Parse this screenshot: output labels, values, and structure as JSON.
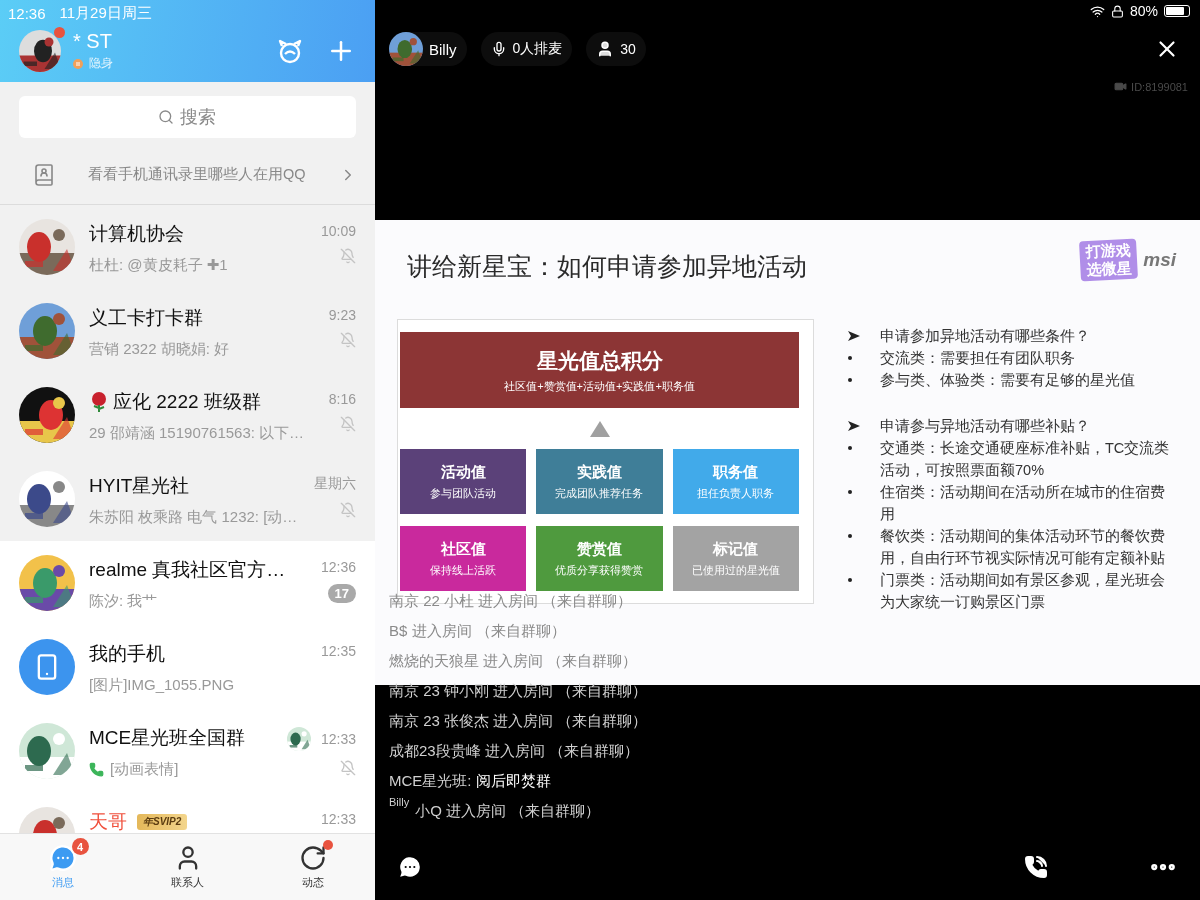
{
  "status_bar": {
    "time": "12:36",
    "date": "11月29日周三",
    "battery": "80%"
  },
  "profile": {
    "name": "* ST",
    "status": "隐身",
    "notification_dot": true
  },
  "search": {
    "placeholder": "搜索"
  },
  "contacts_prompt": "看看手机通讯录里哪些人在用QQ",
  "chats": [
    {
      "name": "计算机协会",
      "preview": "杜杜: @黄皮耗子 ✚1",
      "time": "10:09",
      "muted": true,
      "pinned": true,
      "vip": false
    },
    {
      "name": "义工卡打卡群",
      "preview": "营销 2322 胡晓娟: 好",
      "time": "9:23",
      "muted": true,
      "pinned": true,
      "vip": false
    },
    {
      "rose": true,
      "name": "应化 2222 班级群",
      "preview": "29 邵靖涵 15190761563: 以下…",
      "time": "8:16",
      "muted": true,
      "pinned": true,
      "vip": false
    },
    {
      "name": "HYIT星光社",
      "preview": "朱苏阳 枚乘路 电气 1232: [动…",
      "time": "星期六",
      "muted": true,
      "pinned": true,
      "vip": false
    },
    {
      "name": "realme 真我社区官方…",
      "preview": "陈汐: 我艹",
      "time": "12:36",
      "badge": "17",
      "muted": false,
      "pinned": false,
      "vip": false
    },
    {
      "avatar": {
        "kind": "phone"
      },
      "name": "我的手机",
      "preview": "[图片]IMG_1055.PNG",
      "time": "12:35",
      "muted": false,
      "pinned": false,
      "vip": false
    },
    {
      "name": "MCE星光班全国群",
      "preview": "[动画表情]",
      "call": true,
      "sticker": true,
      "time": "12:33",
      "muted": true,
      "pinned": false,
      "vip": false
    },
    {
      "name": "天哥",
      "tag": "年SVIP2",
      "time": "12:33",
      "muted": false,
      "pinned": false,
      "vip": true
    }
  ],
  "tabs": [
    {
      "label": "消息",
      "selected": true,
      "badge": "4",
      "dot": false
    },
    {
      "label": "联系人",
      "selected": false,
      "dot": false
    },
    {
      "label": "动态",
      "selected": false,
      "dot": true
    }
  ],
  "room": {
    "host": "Billy",
    "queue": "0人排麦",
    "audience": "30",
    "room_id": "ID:8199081"
  },
  "slide": {
    "title": "讲给新星宝：如何申请参加异地活动",
    "logo": {
      "line1": "打游戏",
      "line2": "选微星",
      "brand": "msi"
    },
    "total": {
      "title": "星光值总积分",
      "formula": "社区值+赞赏值+活动值+实践值+职务值"
    },
    "tiles": [
      {
        "title": "活动值",
        "subtitle": "参与团队活动",
        "color": "#5b4179"
      },
      {
        "title": "实践值",
        "subtitle": "完成团队推荐任务",
        "color": "#3f7e98"
      },
      {
        "title": "职务值",
        "subtitle": "担任负责人职务",
        "color": "#41aaea"
      },
      {
        "title": "社区值",
        "subtitle": "保持线上活跃",
        "color": "#c9299d"
      },
      {
        "title": "赞赏值",
        "subtitle": "优质分享获得赞赏",
        "color": "#4f9a3e"
      },
      {
        "title": "标记值",
        "subtitle": "已使用过的星光值",
        "color": "#a3a3a3"
      }
    ],
    "points": [
      {
        "kind": "heading",
        "text": "申请参加异地活动有哪些条件？"
      },
      {
        "kind": "bullet",
        "text": "交流类：需要担任有团队职务"
      },
      {
        "kind": "bullet",
        "text": "参与类、体验类：需要有足够的星光值"
      },
      {
        "kind": "heading",
        "text": "申请参与异地活动有哪些补贴？"
      },
      {
        "kind": "bullet",
        "text": "交通类：长途交通硬座标准补贴，TC交流类活动，可按照票面额70%"
      },
      {
        "kind": "bullet",
        "text": "住宿类：活动期间在活动所在城市的住宿费用"
      },
      {
        "kind": "bullet",
        "text": "餐饮类：活动期间的集体活动环节的餐饮费用，自由行环节视实际情况可能有定额补贴"
      },
      {
        "kind": "bullet",
        "text": "门票类：活动期间如有景区参观，星光班会为大家统一订购景区门票"
      }
    ]
  },
  "messages": [
    {
      "kind": "enter",
      "text": "南京 22  小杜 进入房间 （来自群聊）"
    },
    {
      "kind": "enter",
      "text": "B$ 进入房间 （来自群聊）"
    },
    {
      "kind": "enter",
      "text": "燃烧的天狼星 进入房间 （来自群聊）"
    },
    {
      "kind": "enter",
      "text": "南京 23 钟小刚 进入房间 （来自群聊）"
    },
    {
      "kind": "enter",
      "text": "南京 23 张俊杰 进入房间 （来自群聊）"
    },
    {
      "kind": "enter",
      "text": "成都23段贵峰 进入房间 （来自群聊）"
    },
    {
      "kind": "chat",
      "sender": "MCE星光班:",
      "text": "阅后即焚群"
    },
    {
      "kind": "enter",
      "text": "小Q 进入房间 （来自群聊）",
      "overlay_label": "Billy"
    }
  ]
}
